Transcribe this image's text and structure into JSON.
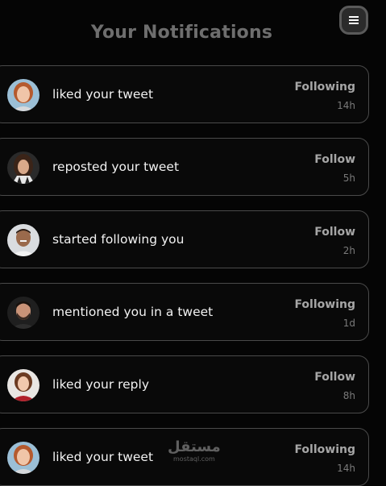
{
  "header": {
    "title": "Your Notifications",
    "menu_icon": "hamburger-menu-icon"
  },
  "notifications": [
    {
      "message": "liked your tweet",
      "action": "Following",
      "time": "14h",
      "avatar": "woman-red-hair-avatar"
    },
    {
      "message": "reposted your tweet",
      "action": "Follow",
      "time": "5h",
      "avatar": "woman-dark-hair-avatar"
    },
    {
      "message": "started following you",
      "action": "Follow",
      "time": "2h",
      "avatar": "man-smiling-avatar"
    },
    {
      "message": "mentioned you in a tweet",
      "action": "Following",
      "time": "1d",
      "avatar": "man-beard-avatar"
    },
    {
      "message": "liked your reply",
      "action": "Follow",
      "time": "8h",
      "avatar": "woman-red-top-avatar"
    },
    {
      "message": "liked your tweet",
      "action": "Following",
      "time": "14h",
      "avatar": "woman-red-hair-avatar"
    }
  ],
  "watermark": {
    "main": "مستقل",
    "sub": "mostaql.com"
  },
  "colors": {
    "background": "#050505",
    "card_border": "#4a4a4a",
    "title": "#6e6e6e"
  }
}
